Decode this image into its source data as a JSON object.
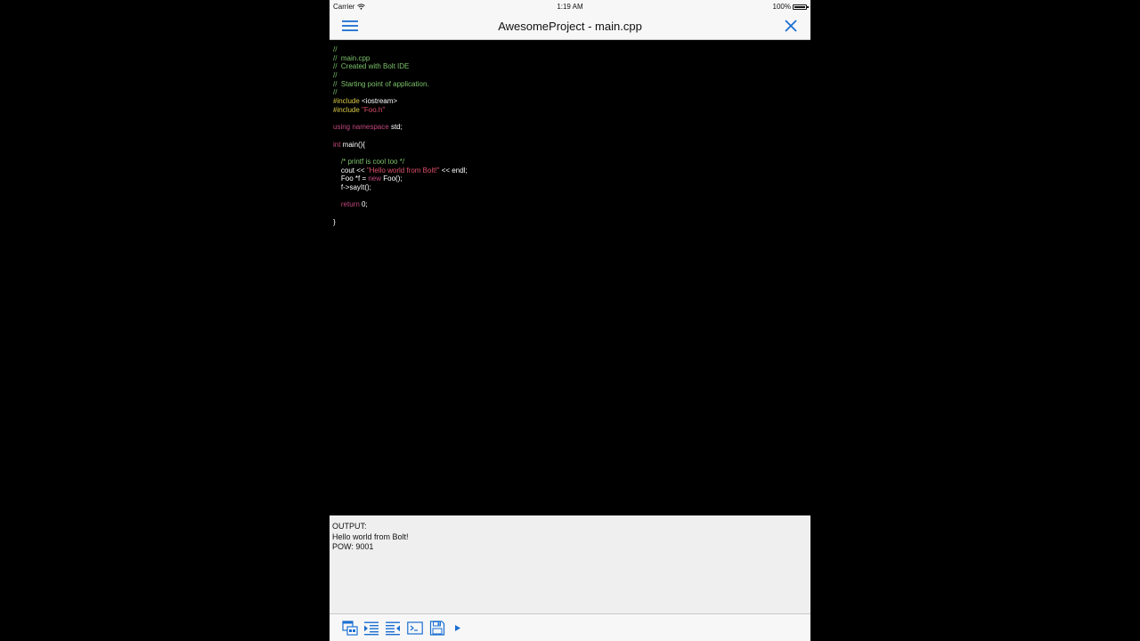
{
  "status_bar": {
    "carrier": "Carrier",
    "time": "1:19 AM",
    "battery": "100%"
  },
  "nav": {
    "title": "AwesomeProject - main.cpp",
    "menu_icon": "hamburger-menu-icon",
    "close_icon": "close-icon"
  },
  "colors": {
    "accent": "#1a6fd1",
    "comment": "#7cc36a",
    "preprocessor": "#d8c848",
    "string": "#e0506a",
    "keyword": "#c2487c",
    "editor_bg": "#000000",
    "output_bg": "#efefef"
  },
  "editor": {
    "lines": [
      [
        {
          "t": "//",
          "c": "comment"
        }
      ],
      [
        {
          "t": "//  main.cpp",
          "c": "comment"
        }
      ],
      [
        {
          "t": "//  Created with Bolt IDE",
          "c": "comment"
        }
      ],
      [
        {
          "t": "//",
          "c": "comment"
        }
      ],
      [
        {
          "t": "//  Starting point of application.",
          "c": "comment"
        }
      ],
      [
        {
          "t": "//",
          "c": "comment"
        }
      ],
      [
        {
          "t": "#include ",
          "c": "preproc"
        },
        {
          "t": "<iostream>",
          "c": "plain"
        }
      ],
      [
        {
          "t": "#include ",
          "c": "preproc"
        },
        {
          "t": "\"Foo.h\"",
          "c": "string"
        }
      ],
      [],
      [
        {
          "t": "using namespace ",
          "c": "keyword"
        },
        {
          "t": "std;",
          "c": "plain"
        }
      ],
      [],
      [
        {
          "t": "int ",
          "c": "keyword"
        },
        {
          "t": "main(){",
          "c": "plain"
        }
      ],
      [],
      [
        {
          "t": "    /* printf is cool too */",
          "c": "comment"
        }
      ],
      [
        {
          "t": "    cout << ",
          "c": "plain"
        },
        {
          "t": "\"Hello world from Bolt!\"",
          "c": "string"
        },
        {
          "t": " << endl;",
          "c": "plain"
        }
      ],
      [
        {
          "t": "    Foo *f = ",
          "c": "plain"
        },
        {
          "t": "new ",
          "c": "keyword"
        },
        {
          "t": "Foo();",
          "c": "plain"
        }
      ],
      [
        {
          "t": "    f->sayIt();",
          "c": "plain"
        }
      ],
      [],
      [
        {
          "t": "    return ",
          "c": "keyword"
        },
        {
          "t": "0;",
          "c": "plain"
        }
      ],
      [],
      [
        {
          "t": "}",
          "c": "plain"
        }
      ]
    ]
  },
  "output": {
    "lines": [
      "OUTPUT:",
      "Hello world from Bolt!",
      "POW: 9001"
    ]
  },
  "toolbar": {
    "tools": [
      {
        "name": "files-icon"
      },
      {
        "name": "indent-icon"
      },
      {
        "name": "outdent-icon"
      },
      {
        "name": "terminal-icon"
      },
      {
        "name": "save-icon"
      },
      {
        "name": "run-icon"
      }
    ]
  }
}
